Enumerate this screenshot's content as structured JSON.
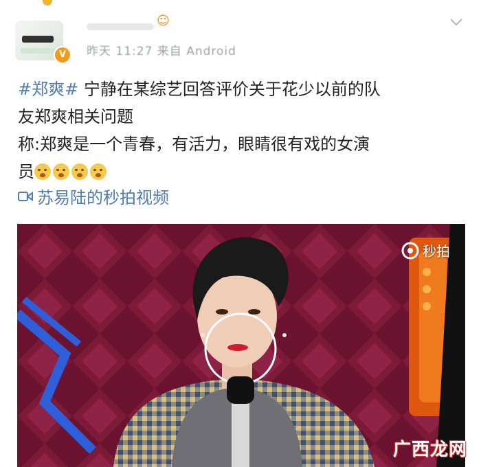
{
  "header": {
    "meta_text": "昨天 11:27 来自 Android",
    "verified_badge": "V",
    "menu_icon": "chevron-down-icon"
  },
  "post": {
    "hashtag": "#郑爽#",
    "line1": "宁静在某综艺回答评价关于花少以前的队",
    "line2": "友郑爽相关问题",
    "line3": "称:郑爽是一个青春，有活力，眼睛很有戏的女演",
    "line4": "员",
    "emoji_icon": "crying-face-icon",
    "video_link": "苏易陆的秒拍视频"
  },
  "video": {
    "platform_label": "秒拍",
    "platform_icon": "camera-icon"
  },
  "watermark": {
    "text": "广西龙网"
  },
  "colors": {
    "link": "#507daf",
    "verified": "#f39a1c",
    "watermark": "#d32f2f"
  }
}
